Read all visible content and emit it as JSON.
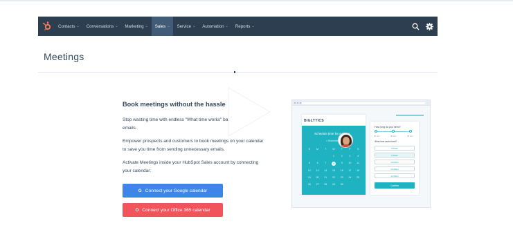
{
  "nav": {
    "items": [
      {
        "label": "Contacts",
        "active": false
      },
      {
        "label": "Conversations",
        "active": false
      },
      {
        "label": "Marketing",
        "active": false
      },
      {
        "label": "Sales",
        "active": true
      },
      {
        "label": "Service",
        "active": false
      },
      {
        "label": "Automation",
        "active": false
      },
      {
        "label": "Reports",
        "active": false
      }
    ],
    "chevron": "⌄"
  },
  "page": {
    "title": "Meetings"
  },
  "promo": {
    "headline": "Book meetings without the hassle",
    "para1": "Stop wasting time with endless \"What time works\" back-and-forth emails.",
    "para2": "Empower prospects and customers to book meetings on your calendar to save you time from sending unnecessary emails.",
    "para3": "Activate Meetings inside your HubSpot Sales account by connecting your calendar:",
    "google_button": "Connect your Google calendar",
    "google_icon": "G",
    "office_button": "Connect your Office 365 calendar",
    "office_icon": "O"
  },
  "illustration": {
    "brand": "BIGLYTICS",
    "schedule_title": "Schedule time for a demo",
    "month": "< November >",
    "days": [
      "S",
      "M",
      "T",
      "W",
      "T",
      "F",
      "S",
      "",
      "",
      "",
      "1",
      "2",
      "3",
      "4",
      "5",
      "6",
      "7",
      "8",
      "9",
      "10",
      "11",
      "12",
      "13",
      "14",
      "15",
      "16",
      "17",
      "18",
      "19",
      "20",
      "21",
      "22",
      "23",
      "24",
      "25",
      "26",
      "27",
      "28",
      "29",
      "30",
      "",
      ""
    ],
    "selected_day": "8",
    "question1": "How long do you need?",
    "durations": [
      "15 min",
      "30 min",
      "45 min"
    ],
    "question2": "What time works best?",
    "slots": [
      "9:00am",
      "9:30am",
      "10:00am",
      "10:30am",
      "11:00am"
    ],
    "confirm": "Confirm"
  },
  "colors": {
    "navbar": "#2d3e50",
    "google": "#3d86e8",
    "office": "#f2545b",
    "teal": "#1fb3c2"
  },
  "icons": {
    "logo": "hubspot-sprocket-icon",
    "search": "search-icon",
    "settings": "gear-icon",
    "video": "play-icon"
  }
}
